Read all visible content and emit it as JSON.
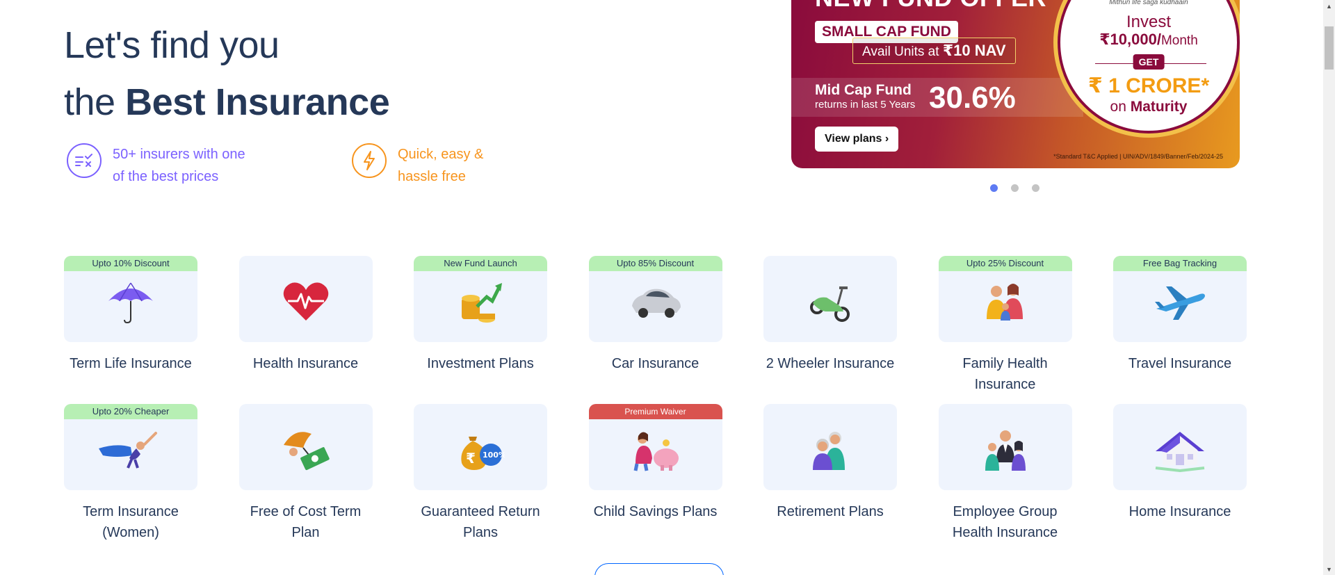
{
  "hero": {
    "line1": "Let's find you",
    "line2_prefix": "the ",
    "line2_bold": "Best Insurance"
  },
  "features": [
    {
      "text_line1": "50+ insurers with one",
      "text_line2": "of the best prices",
      "icon": "compare-icon",
      "color": "#7b61ff"
    },
    {
      "text_line1": "Quick, easy &",
      "text_line2": "hassle free",
      "icon": "lightning-icon",
      "color": "#f7941d"
    }
  ],
  "banner": {
    "title": "NEW FUND OFFER",
    "pill": "SMALL CAP FUND",
    "nav_prefix": "Avail Units at ",
    "nav_value": "₹10 NAV",
    "mid_title": "Mid Cap Fund",
    "mid_sub": "returns in last 5 Years",
    "mid_pct": "30.6%",
    "cta": "View plans ›",
    "disclaimer": "*Standard T&C Applied | UIN/ADV/1849/Banner/Feb/2024-25",
    "tagline": "Mithun life saga kudhaain",
    "invest_label": "Invest",
    "invest_amount": "₹10,000/",
    "invest_period": "Month",
    "get": "GET",
    "crore": "₹ 1 CRORE*",
    "maturity_prefix": "on ",
    "maturity": "Maturity"
  },
  "carousel": {
    "active": 0,
    "count": 3
  },
  "products": [
    {
      "label": "Term Life Insurance",
      "badge": "Upto 10% Discount",
      "icon": "umbrella-icon"
    },
    {
      "label": "Health Insurance",
      "badge": "",
      "icon": "heartbeat-icon"
    },
    {
      "label": "Investment Plans",
      "badge": "New Fund Launch",
      "icon": "coins-growth-icon"
    },
    {
      "label": "Car Insurance",
      "badge": "Upto 85% Discount",
      "icon": "car-icon"
    },
    {
      "label": "2 Wheeler Insurance",
      "badge": "",
      "icon": "scooter-icon"
    },
    {
      "label": "Family Health Insurance",
      "badge": "Upto 25% Discount",
      "icon": "family-icon"
    },
    {
      "label": "Travel Insurance",
      "badge": "Free Bag Tracking",
      "icon": "airplane-icon"
    },
    {
      "label": "Term Insurance (Women)",
      "badge": "Upto 20% Cheaper",
      "icon": "superwoman-icon"
    },
    {
      "label": "Free of Cost Term Plan",
      "badge": "",
      "icon": "umbrella-cash-icon"
    },
    {
      "label": "Guaranteed Return Plans",
      "badge": "",
      "icon": "money-bag-icon"
    },
    {
      "label": "Child Savings Plans",
      "badge": "Premium Waiver",
      "icon": "piggy-bank-icon"
    },
    {
      "label": "Retirement Plans",
      "badge": "",
      "icon": "elderly-couple-icon"
    },
    {
      "label": "Employee Group Health Insurance",
      "badge": "",
      "icon": "employees-icon"
    },
    {
      "label": "Home Insurance",
      "badge": "",
      "icon": "house-icon"
    }
  ]
}
